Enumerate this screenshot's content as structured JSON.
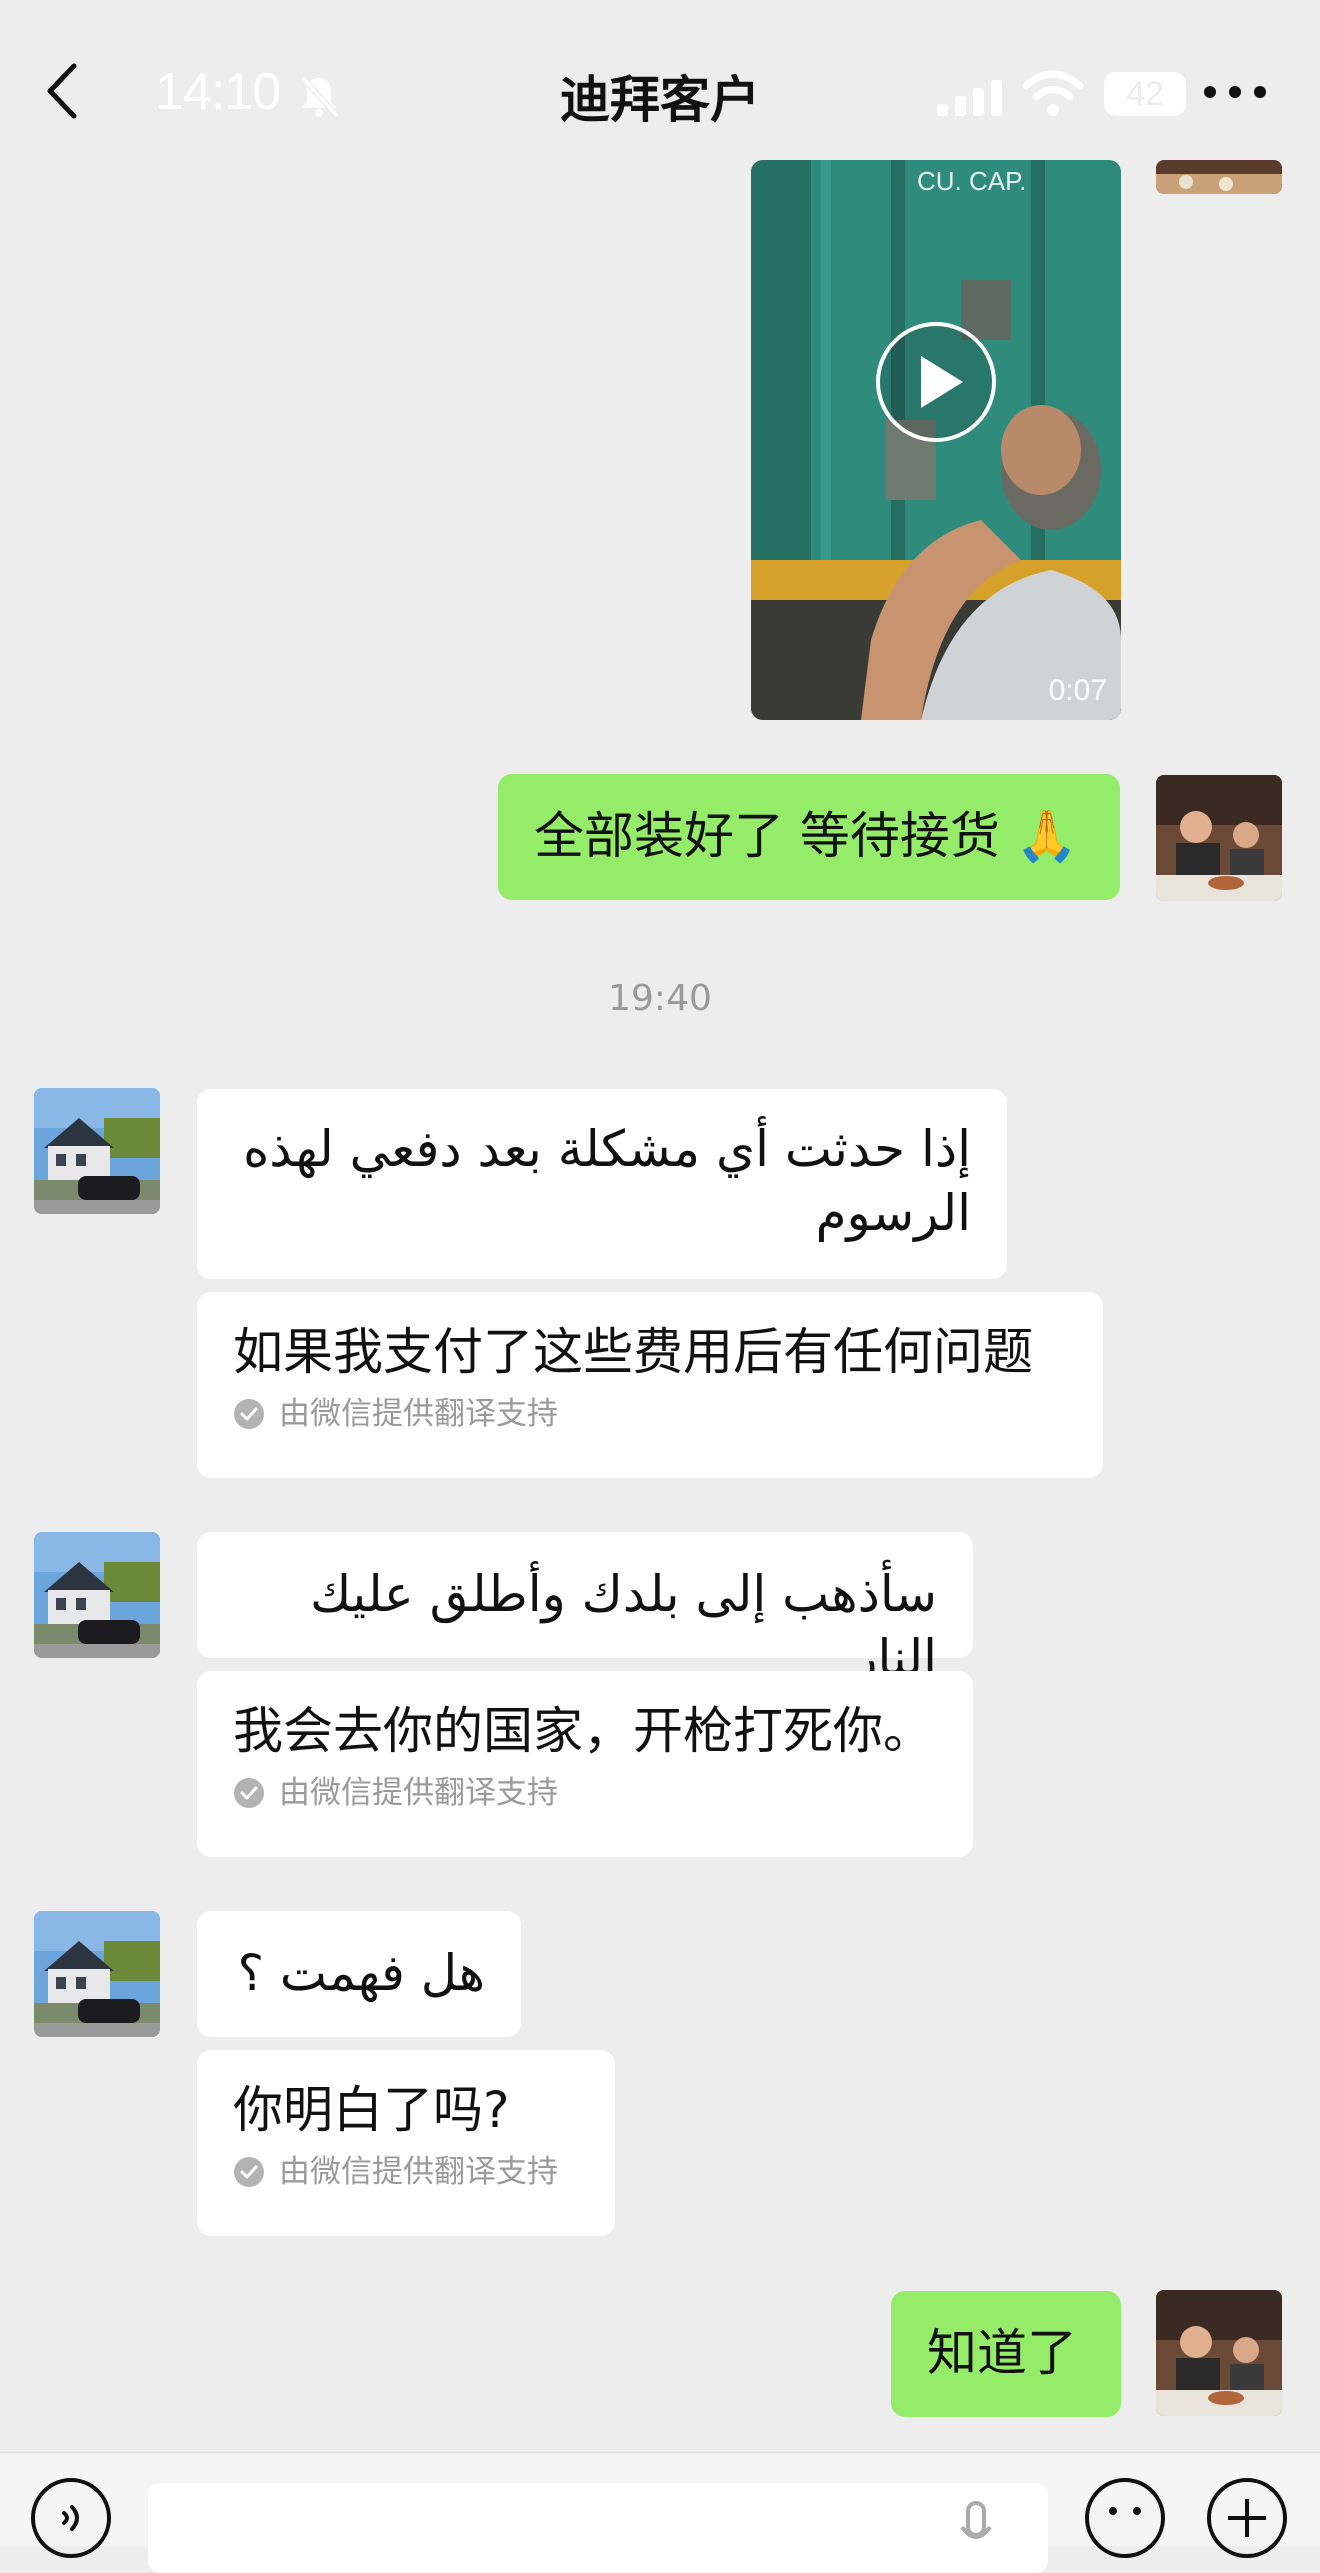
{
  "status_bar": {
    "time": "14:10",
    "battery": "42"
  },
  "header": {
    "title": "迪拜客户"
  },
  "messages": {
    "video": {
      "duration": "0:07",
      "overlay_text": "CU. CAP."
    },
    "sent_1": {
      "text": "全部装好了 等待接货",
      "emoji": "🙏"
    },
    "timestamp": "19:40",
    "recv_1": {
      "arabic": "إذا حدثت أي مشكلة بعد دفعي لهذه الرسوم",
      "translation": "如果我支付了这些费用后有任何问题",
      "translation_note": "由微信提供翻译支持"
    },
    "recv_2": {
      "arabic": "سأذهب إلى بلدك وأطلق عليك النار",
      "translation": "我会去你的国家，开枪打死你。",
      "translation_note": "由微信提供翻译支持"
    },
    "recv_3": {
      "arabic": "هل فهمت ؟",
      "translation": "你明白了吗?",
      "translation_note": "由微信提供翻译支持"
    },
    "sent_2": {
      "text": "知道了"
    }
  },
  "colors": {
    "background": "#ededed",
    "sent_bubble": "#95ec69",
    "received_bubble": "#ffffff",
    "meta_text": "#9a9a9a"
  },
  "icons": [
    "back-arrow-icon",
    "bell-muted-icon",
    "signal-icon",
    "wifi-icon",
    "more-icon",
    "play-icon",
    "check-icon",
    "voice-icon",
    "mic-icon",
    "emoji-icon",
    "plus-icon"
  ]
}
